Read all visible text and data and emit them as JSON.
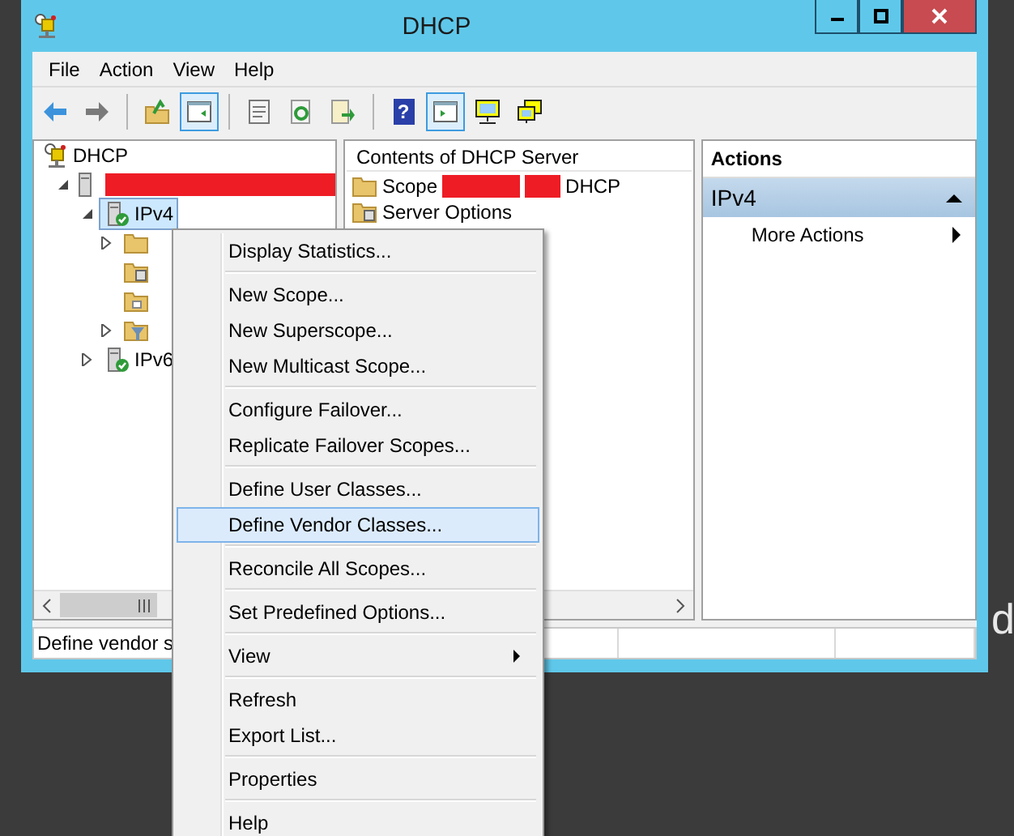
{
  "window": {
    "title": "DHCP"
  },
  "menu_bar": [
    {
      "label": "File"
    },
    {
      "label": "Action"
    },
    {
      "label": "View"
    },
    {
      "label": "Help"
    }
  ],
  "toolbar": [
    {
      "kind": "back",
      "pressed": false
    },
    {
      "kind": "forward",
      "pressed": false
    },
    {
      "kind": "separator"
    },
    {
      "kind": "up",
      "pressed": false
    },
    {
      "kind": "tree",
      "pressed": true
    },
    {
      "kind": "separator"
    },
    {
      "kind": "properties",
      "pressed": false
    },
    {
      "kind": "refresh",
      "pressed": false
    },
    {
      "kind": "export",
      "pressed": false
    },
    {
      "kind": "separator"
    },
    {
      "kind": "help",
      "pressed": false,
      "label": "?"
    },
    {
      "kind": "actionpane",
      "pressed": true
    },
    {
      "kind": "monitor",
      "pressed": false
    },
    {
      "kind": "monitors",
      "pressed": false
    }
  ],
  "tree": [
    {
      "label": "DHCP",
      "kind": "root",
      "children": [
        {
          "kind": "server",
          "redacted": true,
          "expanded": true,
          "children": [
            {
              "label": "IPv4",
              "kind": "ipv",
              "selected": true,
              "expanded": true,
              "children": [
                {
                  "kind": "folder",
                  "expanded": false,
                  "selected": false
                },
                {
                  "kind": "options",
                  "selected": false
                },
                {
                  "kind": "policy",
                  "selected": false
                },
                {
                  "kind": "filter",
                  "expanded": false,
                  "selected": false
                }
              ]
            },
            {
              "label": "IPv6",
              "kind": "ipv",
              "selected": false,
              "expanded": false
            }
          ]
        }
      ]
    }
  ],
  "contents": {
    "header": "Contents of DHCP Server",
    "rows": [
      {
        "kind": "folder",
        "label": "Scope",
        "redacted": true,
        "suffix": "DHCP"
      },
      {
        "kind": "options",
        "label": "Server Options"
      }
    ]
  },
  "actions": {
    "header": "Actions",
    "section": {
      "label": "IPv4",
      "expanded": true
    },
    "items": [
      {
        "label": "More Actions",
        "submenu": true
      }
    ]
  },
  "status_bar": {
    "text": "Define vendor s"
  },
  "context_menu": [
    {
      "kind": "item",
      "label": "Display Statistics...",
      "selected": false
    },
    {
      "kind": "separator"
    },
    {
      "kind": "item",
      "label": "New Scope...",
      "selected": false
    },
    {
      "kind": "item",
      "label": "New Superscope...",
      "selected": false
    },
    {
      "kind": "item",
      "label": "New Multicast Scope...",
      "selected": false
    },
    {
      "kind": "separator"
    },
    {
      "kind": "item",
      "label": "Configure Failover...",
      "selected": false
    },
    {
      "kind": "item",
      "label": "Replicate Failover Scopes...",
      "selected": false
    },
    {
      "kind": "separator"
    },
    {
      "kind": "item",
      "label": "Define User Classes...",
      "selected": false
    },
    {
      "kind": "item",
      "label": "Define Vendor Classes...",
      "selected": true
    },
    {
      "kind": "separator"
    },
    {
      "kind": "item",
      "label": "Reconcile All Scopes...",
      "selected": false
    },
    {
      "kind": "separator"
    },
    {
      "kind": "item",
      "label": "Set Predefined Options...",
      "selected": false
    },
    {
      "kind": "separator"
    },
    {
      "kind": "item",
      "label": "View",
      "selected": false,
      "submenu": true
    },
    {
      "kind": "separator"
    },
    {
      "kind": "item",
      "label": "Refresh",
      "selected": false
    },
    {
      "kind": "item",
      "label": "Export List...",
      "selected": false
    },
    {
      "kind": "separator"
    },
    {
      "kind": "item",
      "label": "Properties",
      "selected": false
    },
    {
      "kind": "separator"
    },
    {
      "kind": "item",
      "label": "Help",
      "selected": false
    }
  ],
  "background_text": "d"
}
